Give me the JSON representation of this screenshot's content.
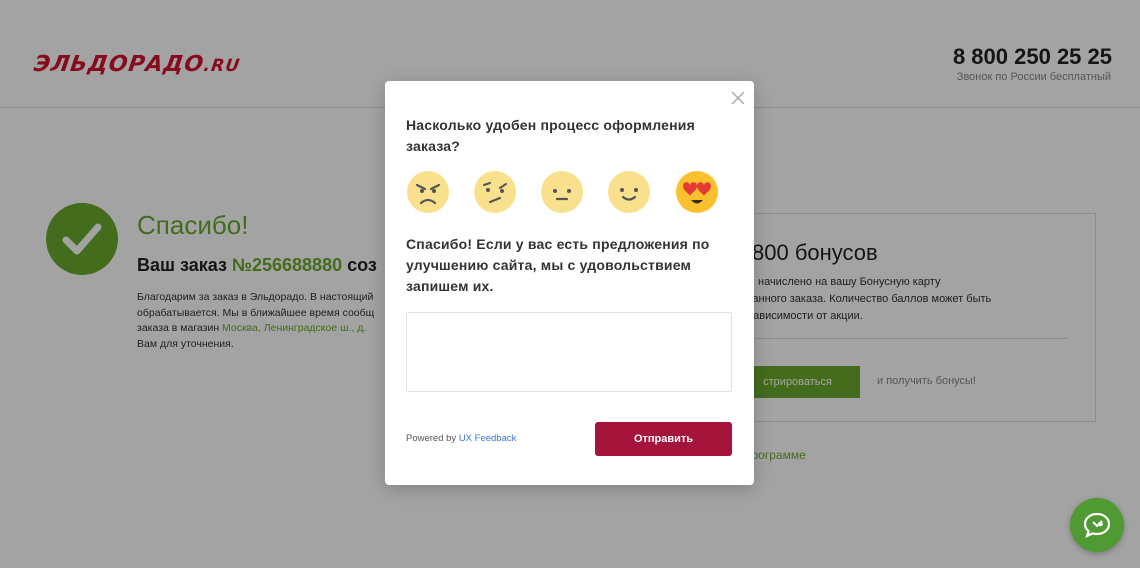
{
  "header": {
    "logo_text": "ЭЛЬДОРАДО",
    "logo_suffix": ".RU",
    "phone": "8 800 250 25 25",
    "phone_note": "Звонок по России бесплатный"
  },
  "order": {
    "title": "Спасибо!",
    "order_prefix": "Ваш заказ ",
    "order_number": "№256688880",
    "order_suffix": " соз",
    "text_1": "Благодарим за заказ в Эльдорадо. В настоящий",
    "text_2": "обрабатывается. Мы в ближайшее время сообщ",
    "text_3": "заказа в магазин ",
    "store_link": "Москва, Ленинградское ш., д.",
    "text_4": "Вам для уточнения."
  },
  "bonus": {
    "title": "800 бонусов",
    "line_1": "начислено на вашу Бонусную карту",
    "line_2": "ты данного заказа. Количество баллов может быть",
    "line_3": "о в зависимости от акции.",
    "register_label": "стрироваться",
    "get_bonus": "и получить бонусы!",
    "program_link": "программе"
  },
  "modal": {
    "question": "Насколько удобен процесс оформления заказа?",
    "emojis": [
      "angry-face-icon",
      "skeptical-face-icon",
      "neutral-face-icon",
      "slight-smile-face-icon",
      "heart-eyes-face-icon"
    ],
    "suggestion_text": "Спасибо! Если у вас есть предложения по улучшению сайта, мы с удовольствием запишем их.",
    "textarea_value": "",
    "powered_by": "Powered by ",
    "powered_brand": "UX Feedback",
    "send_label": "Отправить"
  },
  "colors": {
    "brand_red": "#d3122e",
    "green": "#6aaa2d",
    "send_button": "#a5143a",
    "emoji_yellow": "#f9e08c",
    "selected_emoji": "#fbc02d"
  }
}
